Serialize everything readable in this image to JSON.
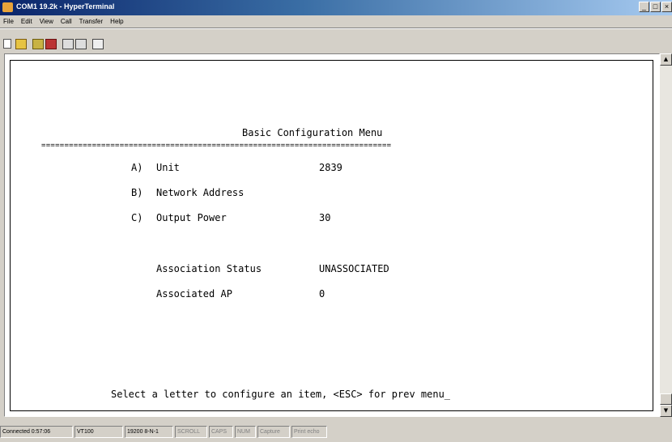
{
  "window": {
    "title": "COM1 19.2k - HyperTerminal",
    "controls": {
      "minimize": "_",
      "maximize": "□",
      "close": "×"
    }
  },
  "menu": [
    "File",
    "Edit",
    "View",
    "Call",
    "Transfer",
    "Help"
  ],
  "toolbar": {
    "icons": [
      "new-icon",
      "open-icon",
      "call-icon",
      "hang-up-icon",
      "send-icon",
      "receive-icon",
      "properties-icon"
    ]
  },
  "terminal": {
    "heading": "Basic Configuration Menu",
    "rule": "============================================================================",
    "items": [
      {
        "key": "A)",
        "label": "Unit",
        "value": "2839"
      },
      {
        "key": "B)",
        "label": "Network Address",
        "value": ""
      },
      {
        "key": "C)",
        "label": "Output Power",
        "value": "30"
      }
    ],
    "status_items": [
      {
        "label": "Association Status",
        "value": "UNASSOCIATED"
      },
      {
        "label": "Associated AP",
        "value": "0"
      }
    ],
    "prompt": "Select a letter to configure an item, <ESC> for prev menu_"
  },
  "statusbar": {
    "connected": "Connected 0:57:06",
    "emulation": "VT100",
    "settings": "19200 8-N-1",
    "scroll": "SCROLL",
    "caps": "CAPS",
    "num": "NUM",
    "capture": "Capture",
    "print_echo": "Print echo"
  }
}
